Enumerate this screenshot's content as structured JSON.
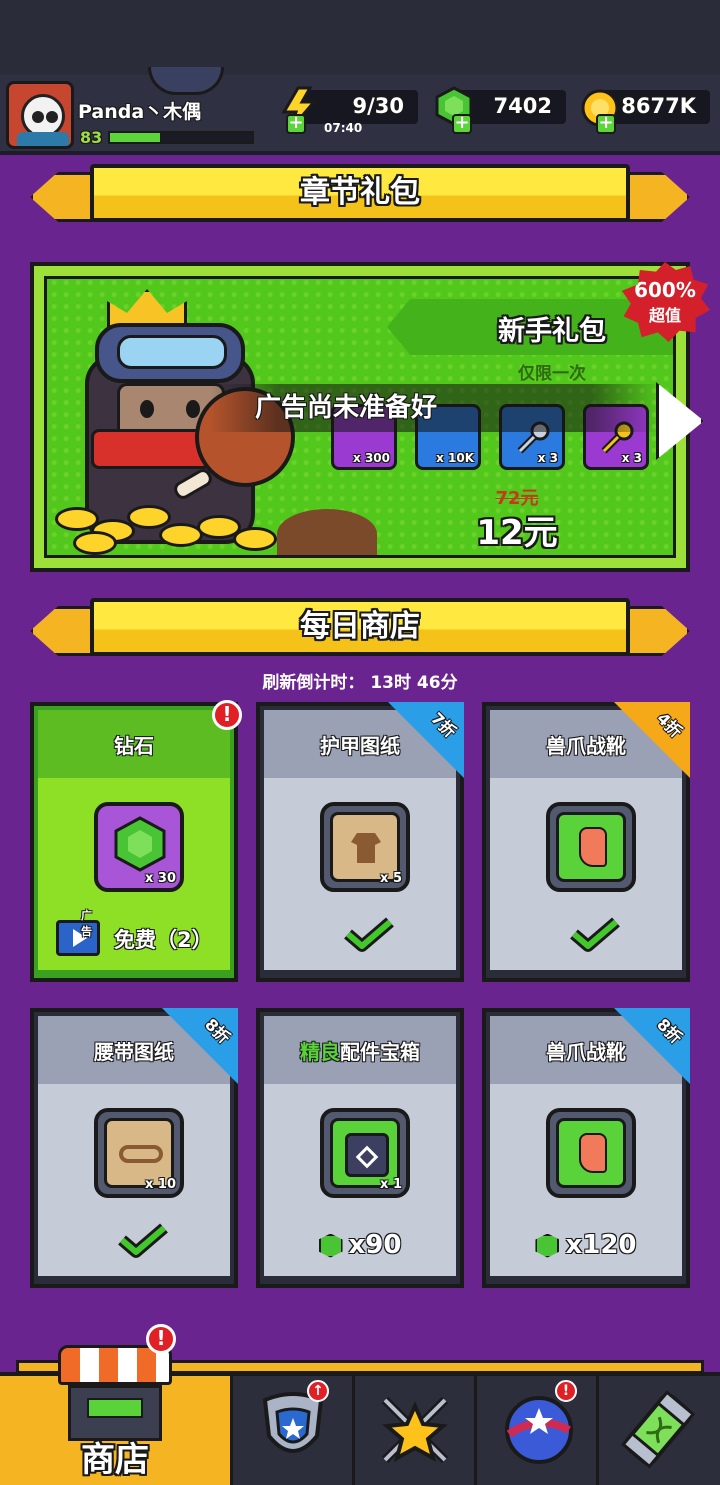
{
  "header": {
    "player_name": "Panda丶木偶",
    "level": "83",
    "xp_fraction": 0.35,
    "energy": "9/30",
    "energy_timer": "07:40",
    "gems": "7402",
    "gold": "8677K"
  },
  "chapter_pack": {
    "banner": "章节礼包",
    "title": "新手礼包",
    "subtitle": "仅限一次",
    "badge_percent": "600%",
    "badge_text": "超值",
    "items": [
      {
        "icon": "gem-icon",
        "count": "x 300",
        "color": "#9b3ad0"
      },
      {
        "icon": "gold-coin-icon",
        "count": "x 10K",
        "color": "#2a7ae0"
      },
      {
        "icon": "silver-key-icon",
        "count": "x 3",
        "color": "#2a7ae0"
      },
      {
        "icon": "gold-key-icon",
        "count": "x 3",
        "color": "#9b3ad0"
      }
    ],
    "old_price": "72元",
    "new_price": "12元",
    "ad_toast": "广告尚未准备好"
  },
  "daily_shop": {
    "banner": "每日商店",
    "refresh_label": "刷新倒计时：",
    "refresh_time": "13时 46分",
    "cards": [
      {
        "name": "钻石",
        "count": "x 30",
        "icon": "gem-icon",
        "ad_label": "广告",
        "free_text": "免费（2）"
      },
      {
        "name": "护甲图纸",
        "count": "x 5",
        "icon": "armor-blueprint-icon",
        "discount": "7折"
      },
      {
        "name": "兽爪战靴",
        "count": "",
        "icon": "claw-boots-icon",
        "discount": "4折"
      },
      {
        "name": "腰带图纸",
        "count": "x 10",
        "icon": "belt-blueprint-icon",
        "discount": "8折"
      },
      {
        "name_highlight": "精良",
        "name_rest": "配件宝箱",
        "count": "x 1",
        "icon": "accessory-chest-icon",
        "price": "x90"
      },
      {
        "name": "兽爪战靴",
        "count": "",
        "icon": "claw-boots-icon",
        "discount": "8折",
        "price": "x120"
      }
    ]
  },
  "nav": {
    "active_label": "商店",
    "tabs": [
      "shop-tab",
      "equipment-tab",
      "battle-tab",
      "talent-tab",
      "evolution-tab"
    ]
  },
  "colors": {
    "background": "#6a2490",
    "accent": "#f5b522",
    "green": "#8ee026",
    "alert": "#e02024"
  }
}
